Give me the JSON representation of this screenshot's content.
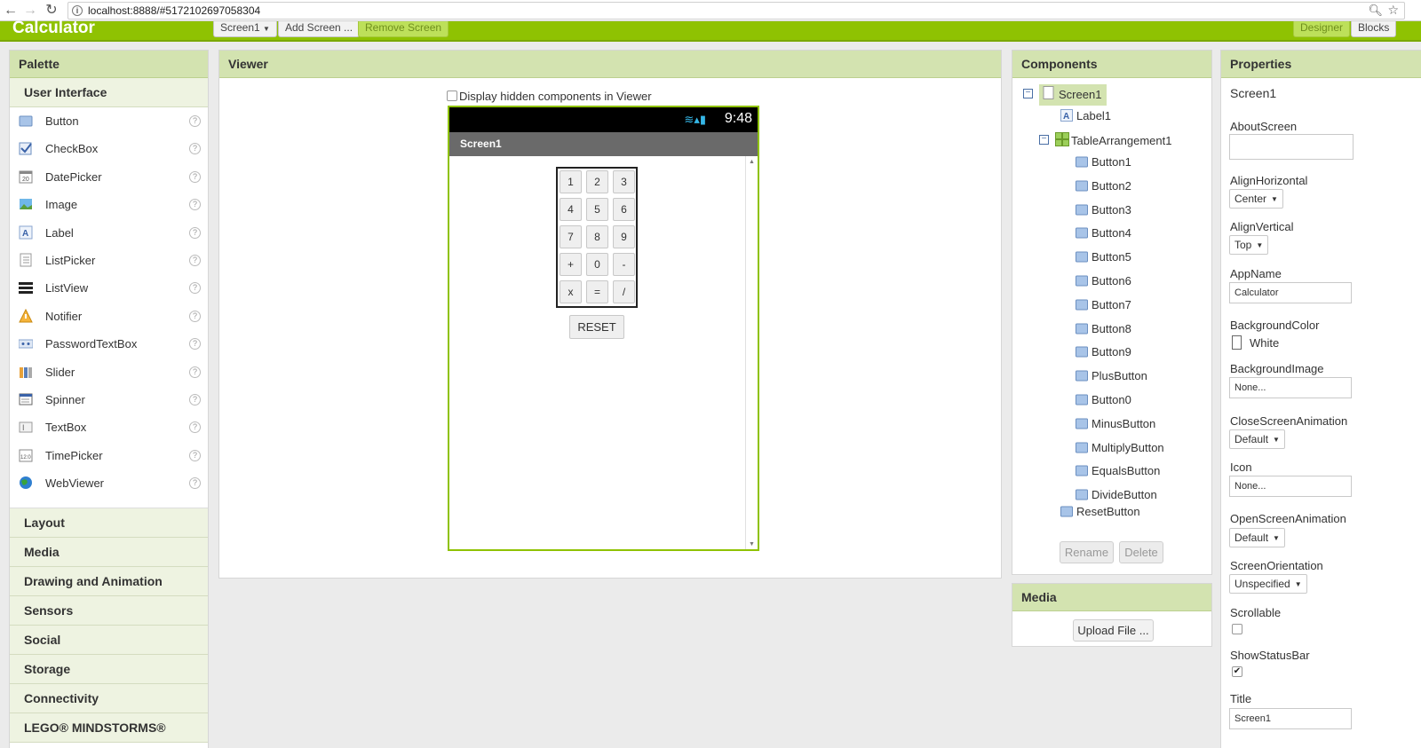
{
  "browser": {
    "back": "←",
    "forward": "→",
    "reload": "↻",
    "url": "localhost:8888/#5172102697058304"
  },
  "app": {
    "title": "Calculator",
    "screen_dropdown": "Screen1",
    "add_screen": "Add Screen ...",
    "remove_screen": "Remove Screen",
    "designer": "Designer",
    "blocks": "Blocks"
  },
  "palette": {
    "header": "Palette",
    "user_interface": "User Interface",
    "items": [
      {
        "label": "Button",
        "icon": "button-icon"
      },
      {
        "label": "CheckBox",
        "icon": "checkbox-icon"
      },
      {
        "label": "DatePicker",
        "icon": "datepicker-icon"
      },
      {
        "label": "Image",
        "icon": "image-icon"
      },
      {
        "label": "Label",
        "icon": "label-icon"
      },
      {
        "label": "ListPicker",
        "icon": "listpicker-icon"
      },
      {
        "label": "ListView",
        "icon": "listview-icon"
      },
      {
        "label": "Notifier",
        "icon": "notifier-icon"
      },
      {
        "label": "PasswordTextBox",
        "icon": "password-icon"
      },
      {
        "label": "Slider",
        "icon": "slider-icon"
      },
      {
        "label": "Spinner",
        "icon": "spinner-icon"
      },
      {
        "label": "TextBox",
        "icon": "textbox-icon"
      },
      {
        "label": "TimePicker",
        "icon": "timepicker-icon"
      },
      {
        "label": "WebViewer",
        "icon": "webviewer-icon"
      }
    ],
    "help": "?",
    "sections": [
      "Layout",
      "Media",
      "Drawing and Animation",
      "Sensors",
      "Social",
      "Storage",
      "Connectivity",
      "LEGO® MINDSTORMS®"
    ]
  },
  "viewer": {
    "header": "Viewer",
    "hidden_label": "Display hidden components in Viewer",
    "time": "9:48",
    "screen_title": "Screen1",
    "buttons": [
      "1",
      "2",
      "3",
      "4",
      "5",
      "6",
      "7",
      "8",
      "9",
      "+",
      "0",
      "-",
      "x",
      "=",
      "/"
    ],
    "reset": "RESET"
  },
  "components": {
    "header": "Components",
    "screen": "Screen1",
    "label": "Label1",
    "table": "TableArrangement1",
    "children": [
      "Button1",
      "Button2",
      "Button3",
      "Button4",
      "Button5",
      "Button6",
      "Button7",
      "Button8",
      "Button9",
      "PlusButton",
      "Button0",
      "MinusButton",
      "MultiplyButton",
      "EqualsButton",
      "DivideButton"
    ],
    "reset": "ResetButton",
    "rename": "Rename",
    "delete": "Delete"
  },
  "media": {
    "header": "Media",
    "upload": "Upload File ..."
  },
  "properties": {
    "header": "Properties",
    "component": "Screen1",
    "about_label": "AboutScreen",
    "about_value": "",
    "align_h_label": "AlignHorizontal",
    "align_h_value": "Center",
    "align_v_label": "AlignVertical",
    "align_v_value": "Top",
    "appname_label": "AppName",
    "appname_value": "Calculator",
    "bgcolor_label": "BackgroundColor",
    "bgcolor_value": "White",
    "bgimage_label": "BackgroundImage",
    "bgimage_value": "None...",
    "close_anim_label": "CloseScreenAnimation",
    "close_anim_value": "Default",
    "icon_label": "Icon",
    "icon_value": "None...",
    "open_anim_label": "OpenScreenAnimation",
    "open_anim_value": "Default",
    "orientation_label": "ScreenOrientation",
    "orientation_value": "Unspecified",
    "scrollable_label": "Scrollable",
    "scrollable_checked": false,
    "statusbar_label": "ShowStatusBar",
    "statusbar_checked": true,
    "title_label": "Title",
    "title_value": "Screen1"
  },
  "colors": {
    "accent": "#8fc202",
    "panel_header": "#d3e3b0"
  }
}
